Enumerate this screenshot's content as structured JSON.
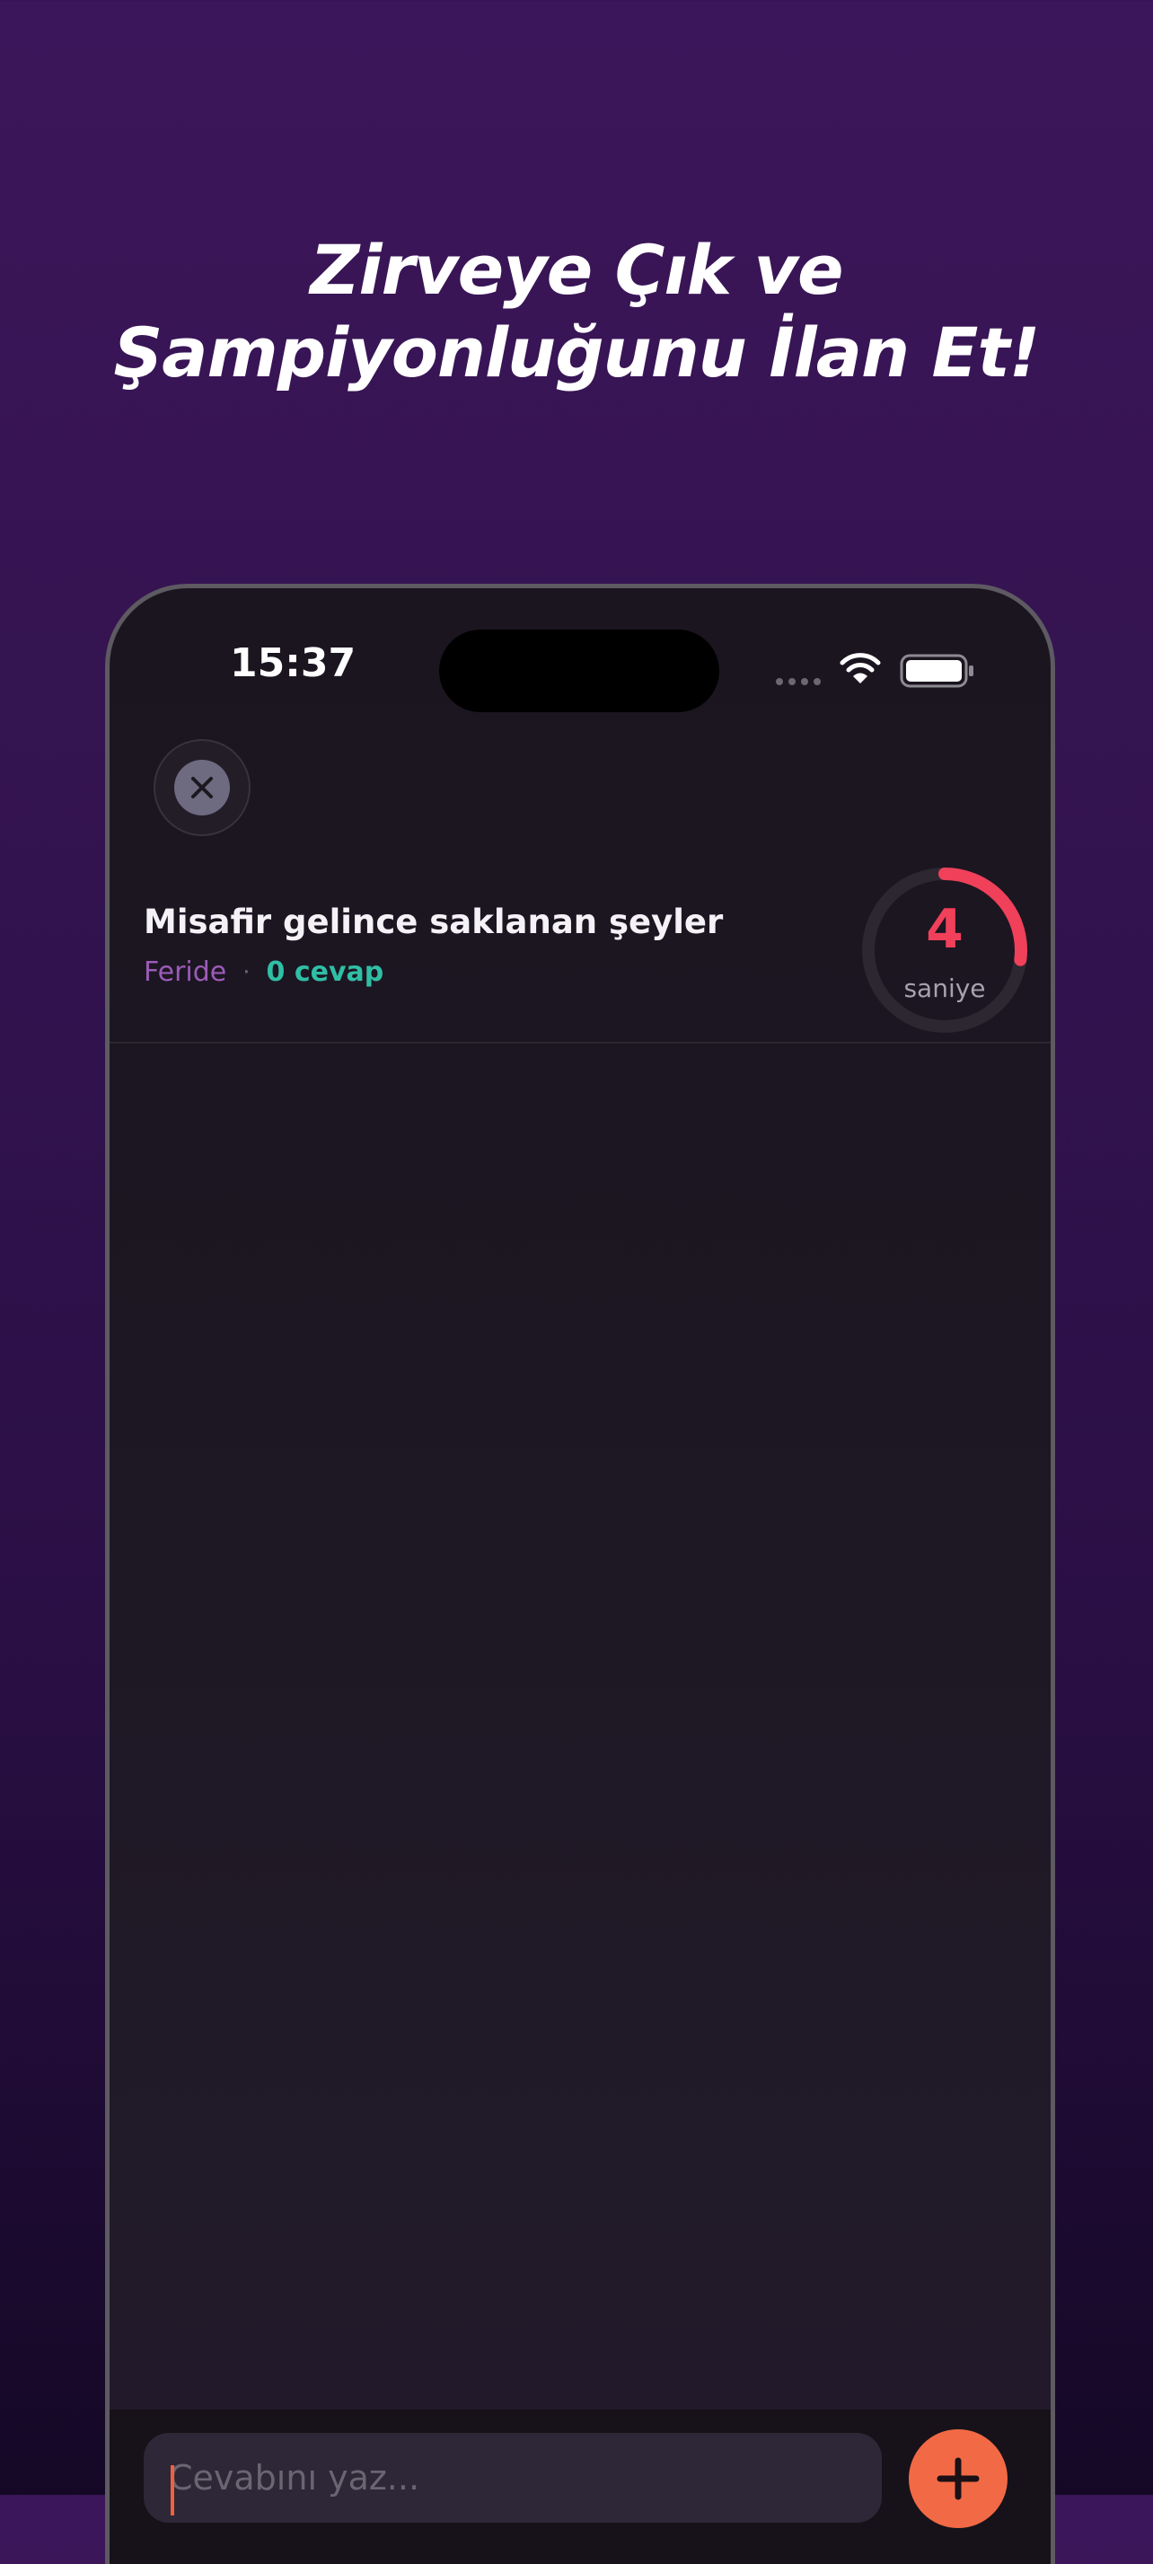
{
  "promo": {
    "headline_line1": "Zirveye Çık ve",
    "headline_line2": "Şampiyonluğunu İlan Et!"
  },
  "status_bar": {
    "time": "15:37"
  },
  "question": {
    "title": "Misafir gelince saklanan şeyler",
    "author": "Feride",
    "separator": "·",
    "answer_count": "0 cevap"
  },
  "timer": {
    "value": "4",
    "unit_label": "saniye",
    "remaining_fraction": 0.27,
    "color": "#f0405a"
  },
  "input": {
    "placeholder": "Cevabını yaz..."
  },
  "icons": {
    "close": "close-icon",
    "add": "plus-icon",
    "wifi": "wifi-icon",
    "battery": "battery-icon"
  },
  "colors": {
    "accent": "#f26a45",
    "author": "#9c5bb8",
    "answer_count": "#2fbfa5"
  }
}
